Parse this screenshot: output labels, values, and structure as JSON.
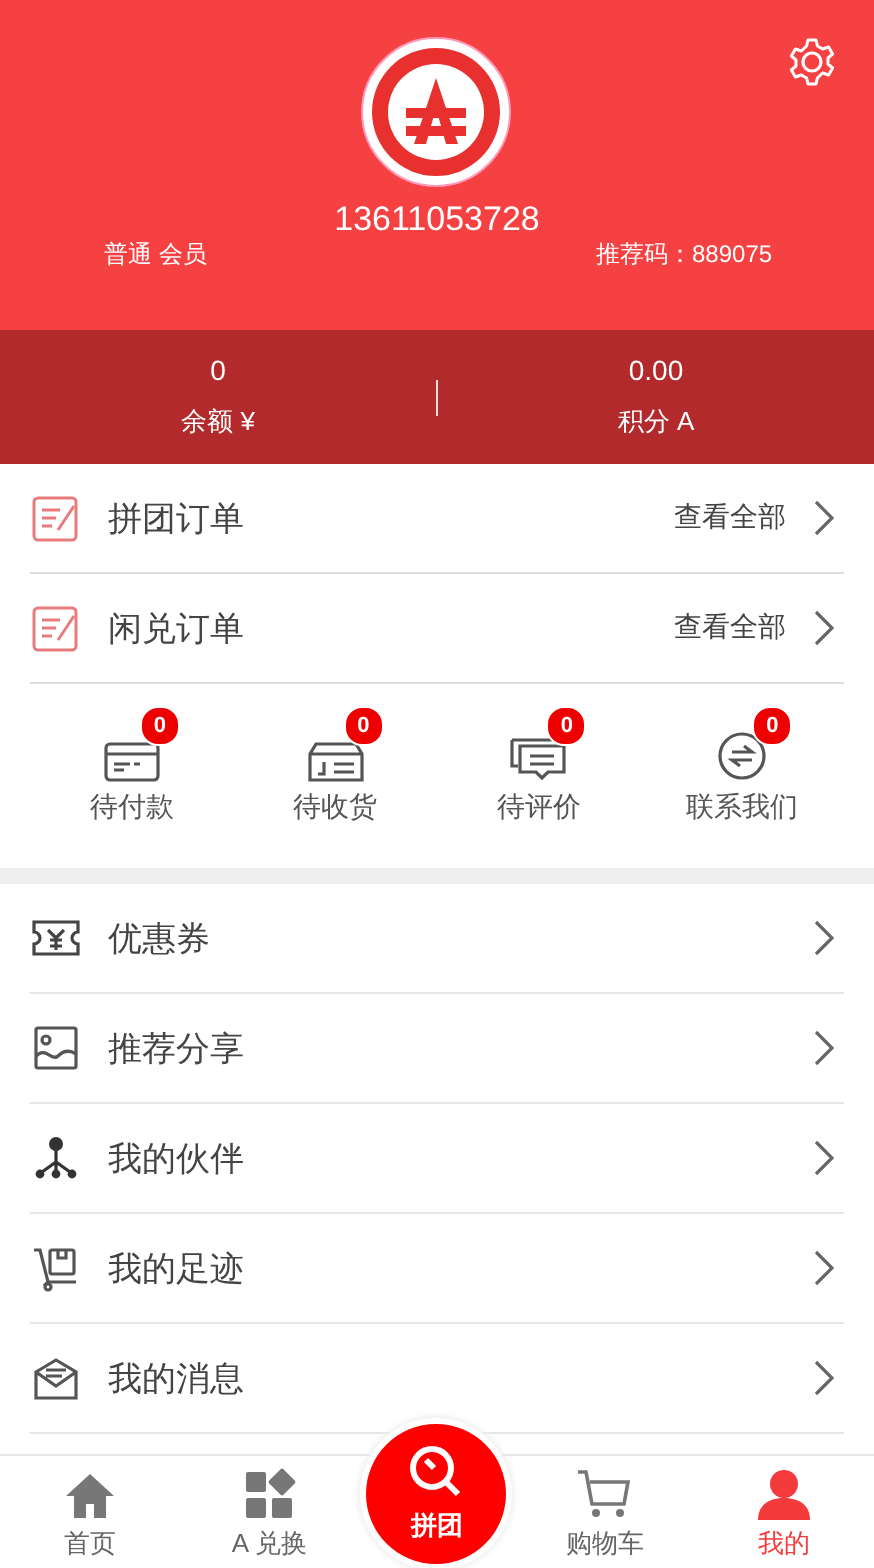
{
  "profile": {
    "phone": "13611053728",
    "member_level": "普通 会员",
    "referral_code": "推荐码：889075"
  },
  "stats": [
    {
      "value": "0",
      "label": "余额 ¥"
    },
    {
      "value": "0.00",
      "label": "积分 A"
    }
  ],
  "orders": [
    {
      "title": "拼团订单",
      "link": "查看全部"
    },
    {
      "title": "闲兑订单",
      "link": "查看全部"
    }
  ],
  "order_status": [
    {
      "label": "待付款",
      "badge": "0"
    },
    {
      "label": "待收货",
      "badge": "0"
    },
    {
      "label": "待评价",
      "badge": "0"
    },
    {
      "label": "联系我们",
      "badge": "0"
    }
  ],
  "menu": [
    {
      "label": "优惠券"
    },
    {
      "label": "推荐分享"
    },
    {
      "label": "我的伙伴"
    },
    {
      "label": "我的足迹"
    },
    {
      "label": "我的消息"
    }
  ],
  "tab_bar": [
    {
      "label": "首页",
      "kind": "normal",
      "selected": false
    },
    {
      "label": "A 兑换",
      "kind": "normal",
      "selected": false
    },
    {
      "label": "拼团",
      "kind": "center",
      "selected": false
    },
    {
      "label": "购物车",
      "kind": "normal",
      "selected": false
    },
    {
      "label": "我的",
      "kind": "normal",
      "selected": true
    }
  ]
}
